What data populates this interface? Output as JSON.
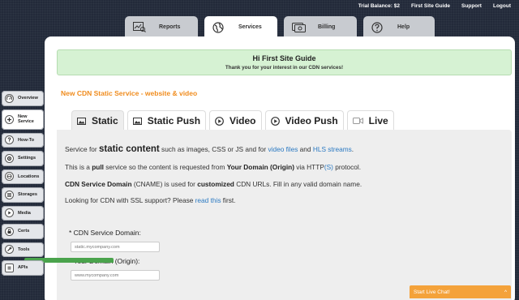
{
  "topbar": {
    "trial_balance": "Trial Balance: $2",
    "guide": "First Site Guide",
    "support": "Support",
    "logout": "Logout"
  },
  "main_tabs": [
    {
      "label": "Reports",
      "icon": "reports-icon"
    },
    {
      "label": "Services",
      "icon": "globe-icon",
      "active": true
    },
    {
      "label": "Billing",
      "icon": "billing-icon"
    },
    {
      "label": "Help",
      "icon": "help-icon"
    }
  ],
  "greeting": {
    "title": "Hi First Site Guide",
    "subtitle": "Thank you for your interest in our CDN services!"
  },
  "service_title": "New CDN Static Service - website & video",
  "service_tabs": [
    {
      "label": "Static",
      "icon": "image-icon",
      "active": true
    },
    {
      "label": "Static Push",
      "icon": "image-icon"
    },
    {
      "label": "Video",
      "icon": "play-icon"
    },
    {
      "label": "Video Push",
      "icon": "play-icon"
    },
    {
      "label": "Live",
      "icon": "camera-icon"
    }
  ],
  "content": {
    "line1": {
      "pre": "Service for ",
      "strong": "static content",
      "mid": " such as images, CSS or JS and for ",
      "link1": "video files",
      "and": " and ",
      "link2": "HLS streams",
      "end": "."
    },
    "line2": {
      "pre": "This is a ",
      "b1": "pull",
      "mid": " service so the content is requested from ",
      "b2": "Your Domain (Origin)",
      "via": " via HTTP",
      "s": "(S)",
      "end": " protocol."
    },
    "line3": {
      "b1": "CDN Service Domain",
      "mid": " (CNAME) is used for ",
      "b2": "customized",
      "end": " CDN URLs. Fill in any valid domain name."
    },
    "line4": {
      "pre": "Looking for CDN with SSL support? Please ",
      "link": "read this",
      "end": " first."
    }
  },
  "form": {
    "cdn_label": "* CDN Service Domain:",
    "cdn_placeholder": "static.mycompany.com",
    "origin_label": "* Your Domain (Origin):",
    "origin_placeholder": "www.mycompany.com"
  },
  "sidebar": [
    {
      "label": "Overview",
      "icon": "overview-icon"
    },
    {
      "label": "New\nService",
      "icon": "plus-icon",
      "active": true
    },
    {
      "label": "How-To",
      "icon": "question-icon"
    },
    {
      "label": "Settings",
      "icon": "gear-icon"
    },
    {
      "label": "Locations",
      "icon": "locations-icon"
    },
    {
      "label": "Storages",
      "icon": "storage-icon"
    },
    {
      "label": "Media",
      "icon": "media-icon"
    },
    {
      "label": "Certs",
      "icon": "cert-icon"
    },
    {
      "label": "Tools",
      "icon": "tools-icon"
    },
    {
      "label": "APIs",
      "icon": "api-icon"
    }
  ],
  "chat": {
    "label": "Start Live Chat!",
    "toggle": "^"
  }
}
